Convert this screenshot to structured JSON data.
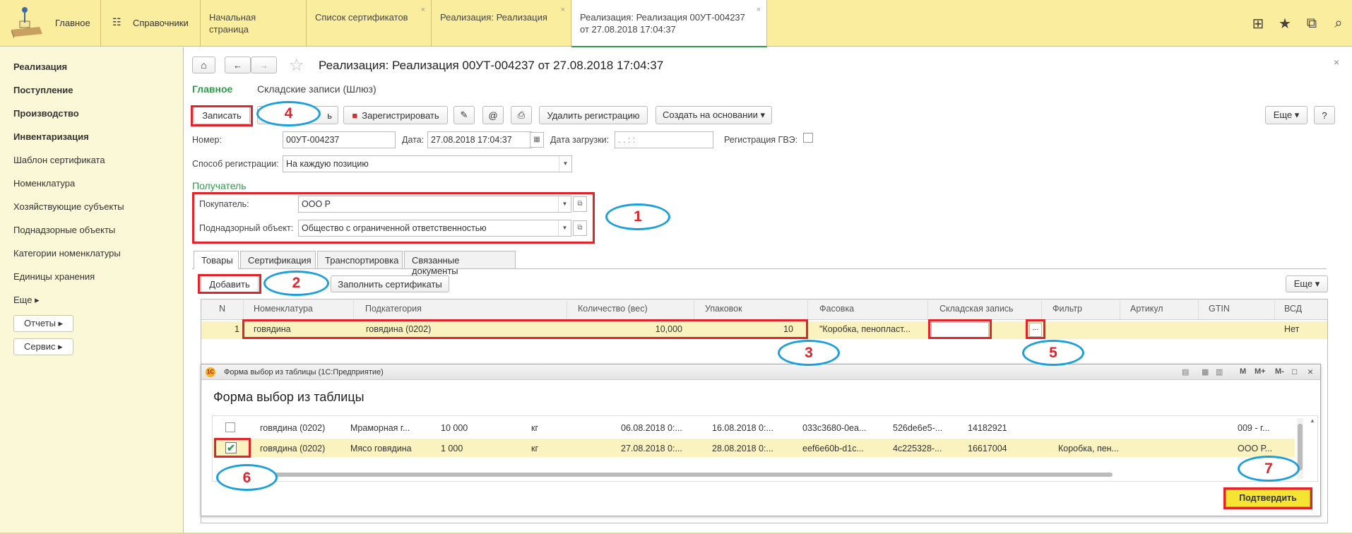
{
  "topbar": {
    "main_label": "Главное",
    "reference_label": "Справочники",
    "tabs": [
      {
        "label": "Начальная страница"
      },
      {
        "label": "Список сертификатов"
      },
      {
        "label": "Реализация: Реализация"
      },
      {
        "label": "Реализация: Реализация 00УТ-004237 от 27.08.2018 17:04:37"
      }
    ],
    "close_glyph": "×"
  },
  "sidebar": {
    "items": [
      {
        "label": "Реализация",
        "bold": true
      },
      {
        "label": "Поступление",
        "bold": true
      },
      {
        "label": "Производство",
        "bold": true
      },
      {
        "label": "Инвентаризация",
        "bold": true
      },
      {
        "label": "Шаблон сертификата"
      },
      {
        "label": "Номенклатура"
      },
      {
        "label": "Хозяйствующие субъекты"
      },
      {
        "label": "Поднадзорные объекты"
      },
      {
        "label": "Категории номенклатуры"
      },
      {
        "label": "Единицы хранения"
      },
      {
        "label": "Еще ▸"
      }
    ],
    "reports_label": "Отчеты ▸",
    "service_label": "Сервис ▸"
  },
  "doc": {
    "title": "Реализация: Реализация 00УТ-004237 от 27.08.2018 17:04:37",
    "subnav_main": "Главное",
    "subnav_stock": "Складские записи (Шлюз)",
    "toolbar": {
      "save": "Записать",
      "post_partial": "ь",
      "register": "Зарегистрировать",
      "delete_reg": "Удалить регистрацию",
      "create_basis": "Создать на основании ▾",
      "more": "Еще ▾",
      "help": "?"
    },
    "number_label": "Номер:",
    "number_value": "00УТ-004237",
    "date_label": "Дата:",
    "date_value": "27.08.2018 17:04:37",
    "load_date_label": "Дата загрузки:",
    "load_date_value": ".  .        :  :",
    "gvz_label": "Регистрация ГВЭ:",
    "reg_method_label": "Способ регистрации:",
    "reg_method_value": "На каждую позицию",
    "recipient_header": "Получатель",
    "buyer_label": "Покупатель:",
    "buyer_value": "ООО  Р",
    "object_label": "Поднадзорный объект:",
    "object_value": "Общество с ограниченной ответственностью"
  },
  "form_tabs": [
    {
      "label": "Товары"
    },
    {
      "label": "Сертификация"
    },
    {
      "label": "Транспортировка"
    },
    {
      "label": "Связанные документы"
    }
  ],
  "goods": {
    "add_label": "Добавить",
    "fill_label": "Заполнить сертификаты",
    "more_label": "Еще ▾",
    "columns": [
      "N",
      "Номенклатура",
      "Подкатегория",
      "Количество (вес)",
      "Упаковок",
      "Фасовка",
      "Складская запись",
      "Фильтр",
      "Артикул",
      "GTIN",
      "ВСД"
    ],
    "row": {
      "n": "1",
      "nomenclature": "говядина",
      "subcategory": "говядина (0202)",
      "quantity": "10,000",
      "packs": "10",
      "packing": "\"Коробка, пенопласт...",
      "stock": "",
      "filter_btn": "...",
      "vsd": "Нет"
    }
  },
  "subwin": {
    "titlebar": "Форма выбор из таблицы  (1С:Предприятие)",
    "heading": "Форма выбор из таблицы",
    "rows": [
      {
        "c1": "говядина (0202)",
        "c2": "Мраморная г...",
        "c3": "10 000",
        "c4": "кг",
        "c5": "06.08.2018 0:...",
        "c6": "16.08.2018 0:...",
        "c7": "033c3680-0ea...",
        "c8": "526de6e5-...",
        "c9": "14182921",
        "c10": "",
        "c11": "009 - г..."
      },
      {
        "c1": "говядина (0202)",
        "c2": "Мясо говядина",
        "c3": "1 000",
        "c4": "кг",
        "c5": "27.08.2018 0:...",
        "c6": "28.08.2018 0:...",
        "c7": "eef6e60b-d1c...",
        "c8": "4c225328-...",
        "c9": "16617004",
        "c10": "Коробка, пен...",
        "c11": "ООО Р..."
      }
    ],
    "confirm_label": "Подтвердить",
    "win_glyphs": [
      "M",
      "M+",
      "M-"
    ]
  },
  "annotations": [
    "1",
    "2",
    "3",
    "4",
    "5",
    "6",
    "7"
  ]
}
